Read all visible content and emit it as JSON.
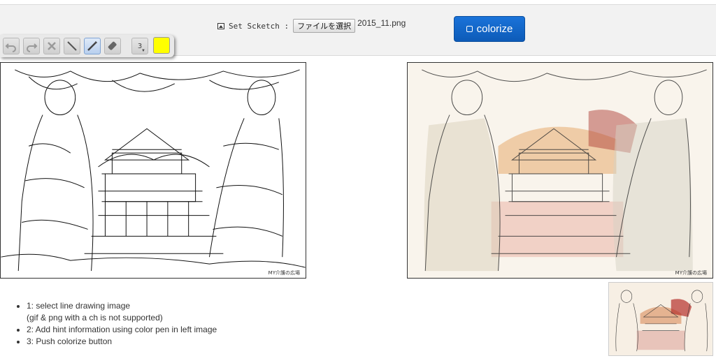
{
  "header": {
    "set_sketch_label": "Set Scketch :",
    "file_button_label": "ファイルを選択",
    "file_name": "2015_11.png",
    "colorize_label": "colorize"
  },
  "toolbar": {
    "tools": [
      "undo-icon",
      "redo-icon",
      "clear-icon",
      "line-icon",
      "pen-icon",
      "eraser-icon"
    ],
    "pen_width": "3",
    "selected_color": "#ffff00"
  },
  "images": {
    "left_watermark": "MY介護の広場",
    "right_watermark": "MY介護の広場"
  },
  "instructions": {
    "step1": "1: select line drawing image",
    "step1_note": "(gif & png with a ch is not supported)",
    "step2": "2: Add hint information using color pen in left image",
    "step3": "3: Push colorize button"
  },
  "colors": {
    "accent": "#0d5bb8",
    "header_bg": "#f2f2f2",
    "pen_color": "#ffff00"
  }
}
